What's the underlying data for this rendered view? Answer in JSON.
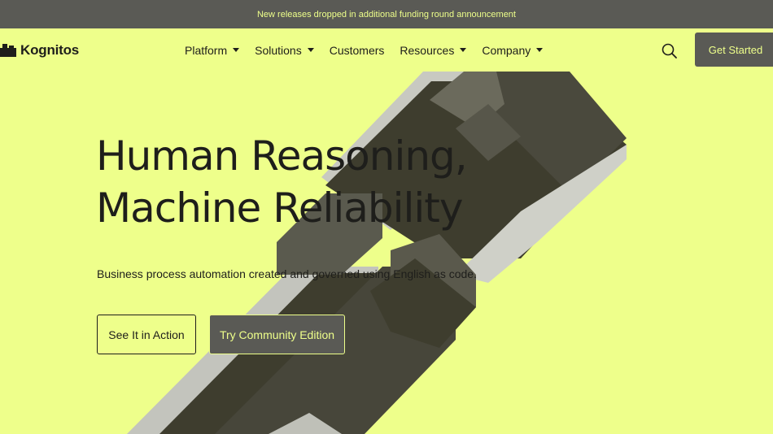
{
  "announcement": {
    "text": "New releases dropped in additional funding round announcement"
  },
  "nav": {
    "logo_text": "Kognitos",
    "items": [
      {
        "label": "Platform",
        "dropdown": true
      },
      {
        "label": "Solutions",
        "dropdown": true
      },
      {
        "label": "Customers",
        "dropdown": false
      },
      {
        "label": "Resources",
        "dropdown": true
      },
      {
        "label": "Company",
        "dropdown": true
      }
    ],
    "search_icon": "search-icon",
    "cta_label": "Get Started"
  },
  "hero": {
    "headline_line1": "Human Reasoning,",
    "headline_line2": "Machine Reliability",
    "subline": "Business process automation created and governed using English as code.",
    "primary_button": "See It in Action",
    "secondary_button": "Try Community Edition"
  },
  "colors": {
    "background": "#eeff8b",
    "dark": "#5a5a55",
    "text": "#1e1e1b",
    "block": "#3e3d2e"
  }
}
